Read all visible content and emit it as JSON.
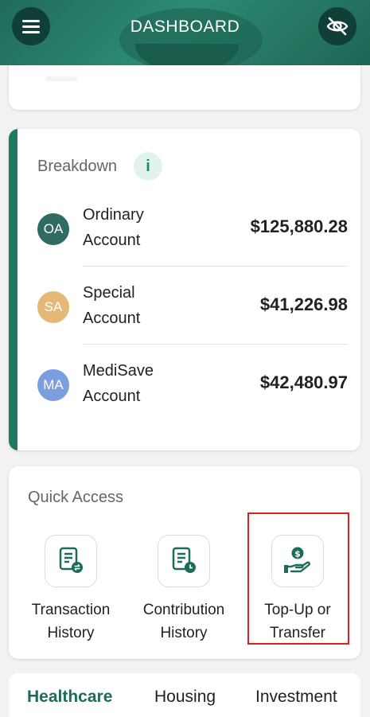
{
  "header": {
    "title": "DASHBOARD",
    "menu_icon": "hamburger-menu-icon",
    "visibility_icon": "eye-slash-icon"
  },
  "breakdown": {
    "title": "Breakdown",
    "info_label": "i",
    "accounts": [
      {
        "badge": "OA",
        "name": "Ordinary Account",
        "amount": "$125,880.28",
        "color": "#2f6b60"
      },
      {
        "badge": "SA",
        "name": "Special Account",
        "amount": "$41,226.98",
        "color": "#e6b878"
      },
      {
        "badge": "MA",
        "name": "MediSave Account",
        "amount": "$42,480.97",
        "color": "#7b9ee0"
      }
    ]
  },
  "quick_access": {
    "title": "Quick Access",
    "items": [
      {
        "label": "Transaction History",
        "icon": "transaction-history-icon"
      },
      {
        "label": "Contribution History",
        "icon": "contribution-history-icon"
      },
      {
        "label": "Top-Up or Transfer",
        "icon": "top-up-transfer-icon"
      }
    ]
  },
  "tabs": [
    {
      "label": "Healthcare",
      "active": true
    },
    {
      "label": "Housing",
      "active": false
    },
    {
      "label": "Investment",
      "active": false
    }
  ],
  "colors": {
    "brand": "#1f7a63",
    "header_dark": "#0f3f37",
    "highlight": "#e02020"
  }
}
